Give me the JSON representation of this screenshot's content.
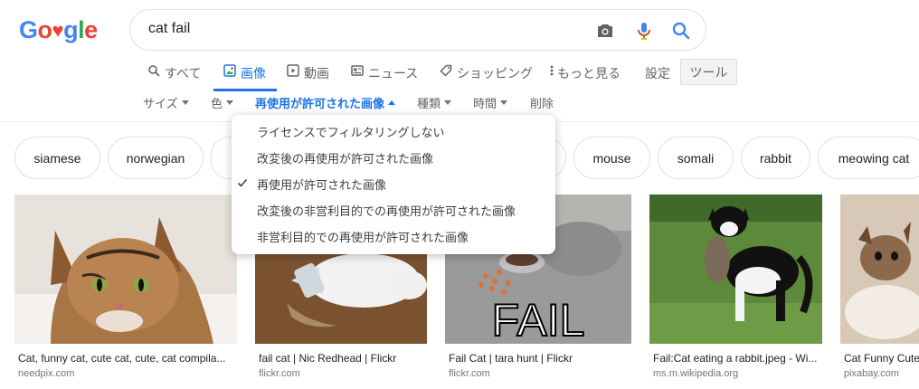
{
  "logo": {
    "text": "Google",
    "letters": [
      "G",
      "o",
      "♥",
      "g",
      "l",
      "e"
    ],
    "colors": [
      "#4285F4",
      "#EA4335",
      "#EA4335",
      "#4285F4",
      "#34A853",
      "#EA4335"
    ]
  },
  "search": {
    "query": "cat fail",
    "camera_icon": "camera-icon",
    "mic_icon": "mic-icon",
    "search_icon": "search-icon"
  },
  "tabs": [
    {
      "label": "すべて",
      "icon": "search-icon",
      "active": false
    },
    {
      "label": "画像",
      "icon": "image-icon",
      "active": true
    },
    {
      "label": "動画",
      "icon": "play-icon",
      "active": false
    },
    {
      "label": "ニュース",
      "icon": "news-icon",
      "active": false
    },
    {
      "label": "ショッピング",
      "icon": "tag-icon",
      "active": false
    },
    {
      "label": "もっと見る",
      "icon": "more-icon",
      "active": false
    }
  ],
  "settings_label": "設定",
  "tools_label": "ツール",
  "filters": [
    {
      "label": "サイズ",
      "active": false
    },
    {
      "label": "色",
      "active": false
    },
    {
      "label": "再使用が許可された画像",
      "active": true
    },
    {
      "label": "種類",
      "active": false
    },
    {
      "label": "時間",
      "active": false
    },
    {
      "label": "削除",
      "active": false
    }
  ],
  "usage_menu": {
    "items": [
      {
        "label": "ライセンスでフィルタリングしない",
        "checked": false
      },
      {
        "label": "改変後の再使用が許可された画像",
        "checked": false
      },
      {
        "label": "再使用が許可された画像",
        "checked": true
      },
      {
        "label": "改変後の非営利目的での再使用が許可された画像",
        "checked": false
      },
      {
        "label": "非営利目的での再使用が許可された画像",
        "checked": false
      }
    ]
  },
  "chips": [
    "siamese",
    "norwegian",
    "",
    "",
    "mouse",
    "somali",
    "rabbit",
    "meowing cat"
  ],
  "results": [
    {
      "title": "Cat, funny cat, cute cat, cute, cat compila...",
      "source": "needpix.com"
    },
    {
      "title": "fail cat | Nic Redhead | Flickr",
      "source": "flickr.com"
    },
    {
      "title": "Fail Cat | tara hunt | Flickr",
      "source": "flickr.com",
      "overlay_text": "FAIL"
    },
    {
      "title": "Fail:Cat eating a rabbit.jpeg - Wi...",
      "source": "ms.m.wikipedia.org"
    },
    {
      "title": "Cat Funny Cute",
      "source": "pixabay.com"
    }
  ],
  "colors": {
    "accent": "#1a73e8",
    "text_muted": "#5f6368"
  }
}
